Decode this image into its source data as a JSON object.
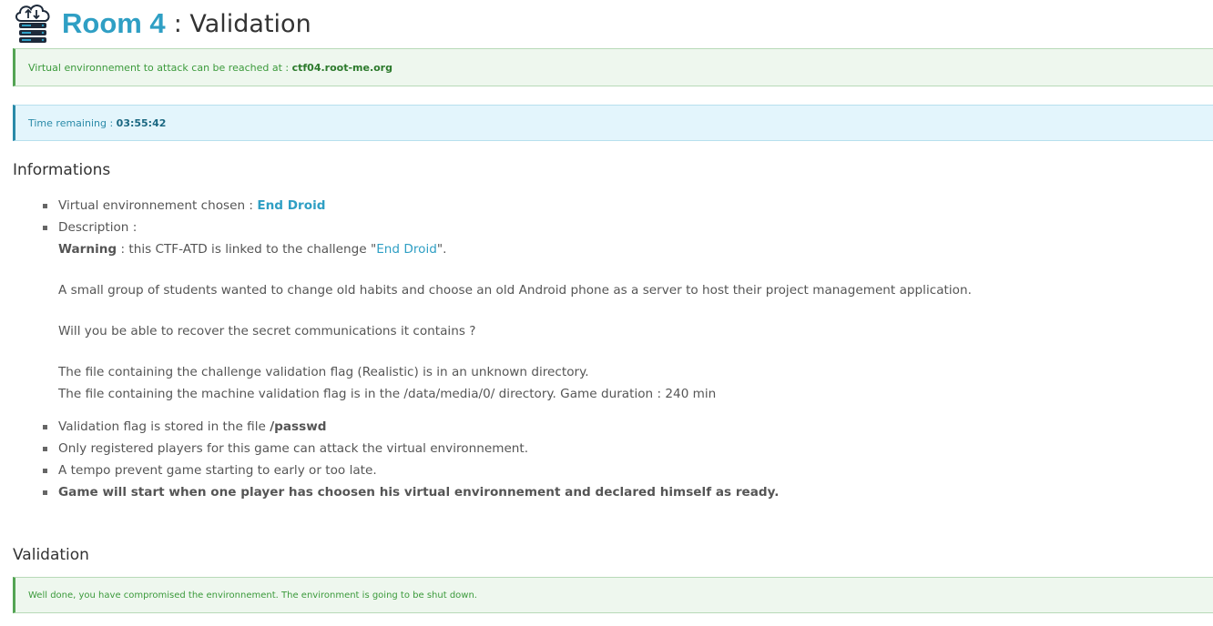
{
  "header": {
    "room": "Room 4",
    "separator_title": ": Validation"
  },
  "alerts": {
    "environment": {
      "prefix": "Virtual environnement to attack can be reached at :",
      "host": "ctf04.root-me.org"
    },
    "time": {
      "prefix": "Time remaining :",
      "value": "03:55:42"
    }
  },
  "informations": {
    "title": "Informations",
    "env_chosen_label": "Virtual environnement chosen :",
    "env_chosen_value": "End Droid",
    "description_label": "Description :",
    "warning_label": "Warning",
    "warning_text_before": ": this CTF-ATD is linked to the challenge \"",
    "warning_link": "End Droid",
    "warning_text_after": "\".",
    "para1": "A small group of students wanted to change old habits and choose an old Android phone as a server to host their project management application.",
    "para2": "Will you be able to recover the secret communications it contains ?",
    "para3_line1": "The file containing the challenge validation flag (Realistic) is in an unknown directory.",
    "para3_line2": "The file containing the machine validation flag is in the /data/media/0/ directory. Game duration : 240 min",
    "flag_label": "Validation flag is stored in the file",
    "flag_file": "/passwd",
    "rule_registered": "Only registered players for this game can attack the virtual environnement.",
    "rule_tempo": "A tempo prevent game starting to early or too late.",
    "rule_start": "Game will start when one player has choosen his virtual environnement and declared himself as ready."
  },
  "validation": {
    "title": "Validation",
    "message": "Well done, you have compromised the environnement. The environment is going to be shut down."
  },
  "icons": {
    "title_icon": "cloud-server-icon"
  },
  "colors": {
    "accent": "#2f9fc4",
    "success": "#3b9a3b",
    "info": "#2a8aa8"
  }
}
